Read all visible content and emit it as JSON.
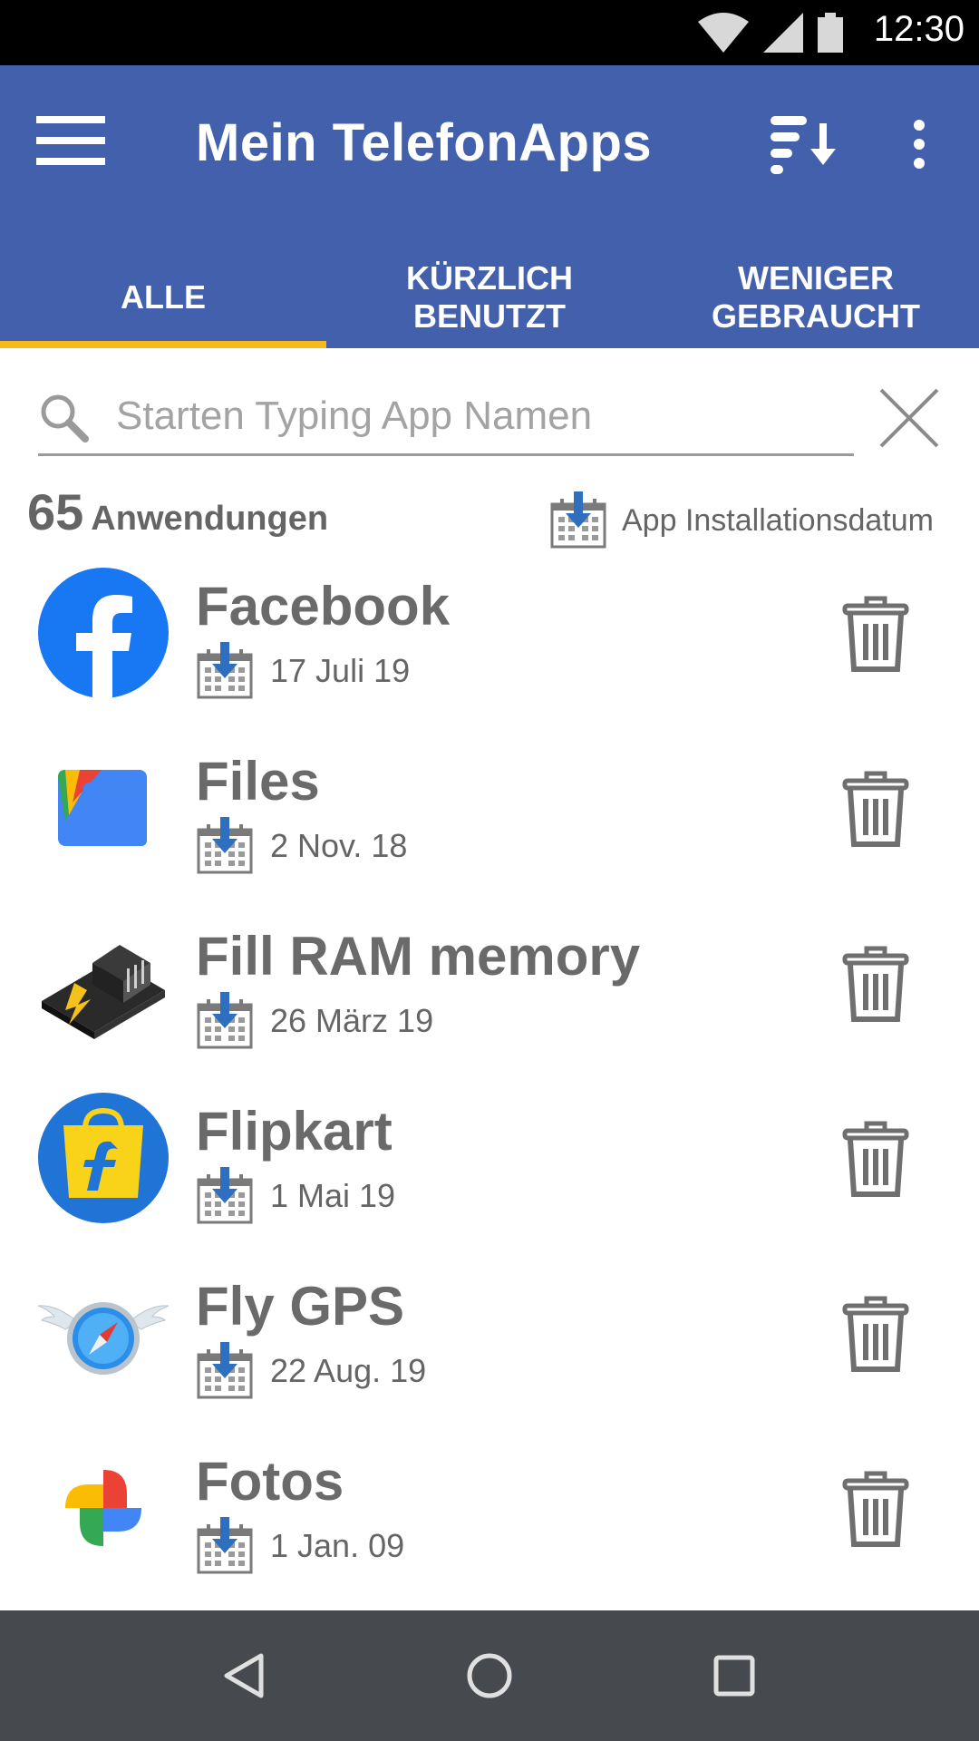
{
  "status_bar": {
    "time": "12:30"
  },
  "toolbar": {
    "title": "Mein TelefonApps"
  },
  "tabs": [
    {
      "label": "ALLE"
    },
    {
      "label": "KÜRZLICH BENUTZT"
    },
    {
      "label": "WENIGER GEBRAUCHT"
    }
  ],
  "search": {
    "placeholder": "Starten Typing App Namen",
    "value": ""
  },
  "summary": {
    "count": "65",
    "count_label": "Anwendungen",
    "sort_label": "App Installationsdatum"
  },
  "apps": [
    {
      "name": "Facebook",
      "date": "17 Juli 19",
      "icon": "facebook-icon"
    },
    {
      "name": "Files",
      "date": "2 Nov. 18",
      "icon": "files-icon"
    },
    {
      "name": "Fill RAM memory",
      "date": "26 März 19",
      "icon": "ram-memory-icon"
    },
    {
      "name": "Flipkart",
      "date": "1 Mai 19",
      "icon": "flipkart-icon"
    },
    {
      "name": "Fly GPS",
      "date": "22 Aug. 19",
      "icon": "fly-gps-icon"
    },
    {
      "name": "Fotos",
      "date": "1 Jan. 09",
      "icon": "photos-icon"
    }
  ],
  "colors": {
    "primary": "#4260ab",
    "tab_indicator": "#f6bb18",
    "text_gray": "#656565",
    "nav_bar": "#464a4f"
  }
}
